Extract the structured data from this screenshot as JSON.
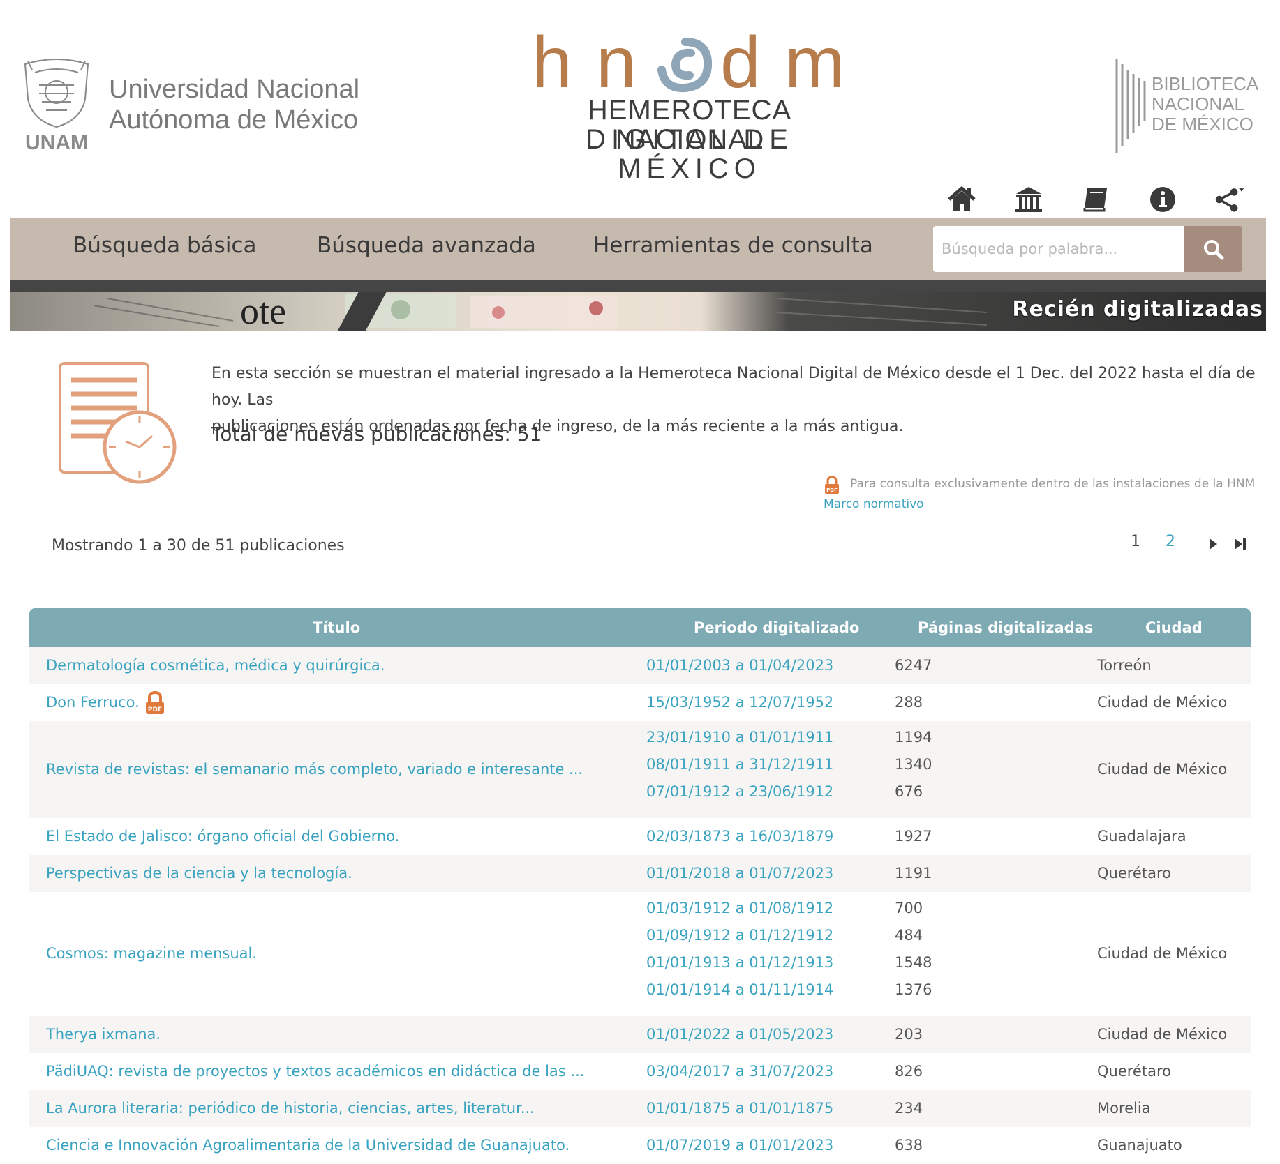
{
  "header": {
    "unam_line1": "Universidad Nacional",
    "unam_line2": "Autónoma de México",
    "unam_abbrev": "UNAM",
    "hndm_letters": [
      "h",
      "n",
      "d",
      "m"
    ],
    "hndm_line1": "HEMEROTECA NACIONAL",
    "hndm_line2": "DIGITAL DE MÉXICO",
    "bnm_line1": "BIBLIOTECA",
    "bnm_line2": "NACIONAL",
    "bnm_line3": "DE MÉXICO"
  },
  "utility_icons": [
    "home-icon",
    "institution-icon",
    "book-icon",
    "info-icon",
    "share-icon"
  ],
  "nav": {
    "items": [
      "Búsqueda básica",
      "Búsqueda avanzada",
      "Herramientas de consulta"
    ],
    "search_placeholder": "Búsqueda por palabra..."
  },
  "banner": {
    "title": "Recién digitalizadas"
  },
  "intro": {
    "line1": "En esta sección se muestran el material ingresado a la Hemeroteca Nacional Digital de México desde el 1 Dec. del 2022 hasta el día de hoy. Las",
    "line2": "publicaciones están ordenadas por fecha de ingreso, de la más reciente a la más antigua.",
    "total": "Total de nuevas publicaciones: 51",
    "lock_note": "Para consulta exclusivamente dentro de las instalaciones de la HNM",
    "marco": "Marco normativo"
  },
  "pagination": {
    "showing": "Mostrando 1 a 30 de 51 publicaciones",
    "pages": [
      "1",
      "2"
    ],
    "current_page": "1"
  },
  "table": {
    "headers": [
      "Título",
      "Periodo digitalizado",
      "Páginas digitalizadas",
      "Ciudad"
    ],
    "rows": [
      {
        "title": "Dermatología cosmética, médica y quirúrgica.",
        "lock": false,
        "city": "Torreón",
        "periods": [
          {
            "period": "01/01/2003 a 01/04/2023",
            "pages": "6247"
          }
        ]
      },
      {
        "title": "Don Ferruco.",
        "lock": true,
        "city": "Ciudad de México",
        "periods": [
          {
            "period": "15/03/1952 a 12/07/1952",
            "pages": "288"
          }
        ]
      },
      {
        "title": "Revista de revistas: el semanario más completo, variado e interesante ...",
        "lock": false,
        "city": "Ciudad de México",
        "periods": [
          {
            "period": "23/01/1910 a 01/01/1911",
            "pages": "1194"
          },
          {
            "period": "08/01/1911 a 31/12/1911",
            "pages": "1340"
          },
          {
            "period": "07/01/1912 a 23/06/1912",
            "pages": "676"
          }
        ]
      },
      {
        "title": "El Estado de Jalisco: órgano oficial del Gobierno.",
        "lock": false,
        "city": "Guadalajara",
        "periods": [
          {
            "period": "02/03/1873 a 16/03/1879",
            "pages": "1927"
          }
        ]
      },
      {
        "title": "Perspectivas de la ciencia y la tecnología.",
        "lock": false,
        "city": "Querétaro",
        "periods": [
          {
            "period": "01/01/2018 a 01/07/2023",
            "pages": "1191"
          }
        ]
      },
      {
        "title": "Cosmos: magazine mensual.",
        "lock": false,
        "city": "Ciudad de México",
        "periods": [
          {
            "period": "01/03/1912 a 01/08/1912",
            "pages": "700"
          },
          {
            "period": "01/09/1912 a 01/12/1912",
            "pages": "484"
          },
          {
            "period": "01/01/1913 a 01/12/1913",
            "pages": "1548"
          },
          {
            "period": "01/01/1914 a 01/11/1914",
            "pages": "1376"
          }
        ]
      },
      {
        "title": "Therya ixmana.",
        "lock": false,
        "city": "Ciudad de México",
        "periods": [
          {
            "period": "01/01/2022 a 01/05/2023",
            "pages": "203"
          }
        ]
      },
      {
        "title": "PädiUAQ: revista de proyectos y textos académicos en didáctica de las ...",
        "lock": false,
        "city": "Querétaro",
        "periods": [
          {
            "period": "03/04/2017 a 31/07/2023",
            "pages": "826"
          }
        ]
      },
      {
        "title": "La Aurora literaria: periódico de historia, ciencias, artes, literatur...",
        "lock": false,
        "city": "Morelia",
        "periods": [
          {
            "period": "01/01/1875 a 01/01/1875",
            "pages": "234"
          }
        ]
      },
      {
        "title": "Ciencia e Innovación Agroalimentaria de la Universidad de Guanajuato.",
        "lock": false,
        "city": "Guanajuato",
        "periods": [
          {
            "period": "01/07/2019 a 01/01/2023",
            "pages": "638"
          }
        ]
      }
    ]
  },
  "colors": {
    "brand_copper": "#b77c4c",
    "brand_blue": "#8fa6b8",
    "nav_bg": "#c6b9ae",
    "search_btn": "#a58c7e",
    "table_header": "#7eaab4",
    "link": "#3aa3c0",
    "lock_orange": "#e07a3c"
  }
}
